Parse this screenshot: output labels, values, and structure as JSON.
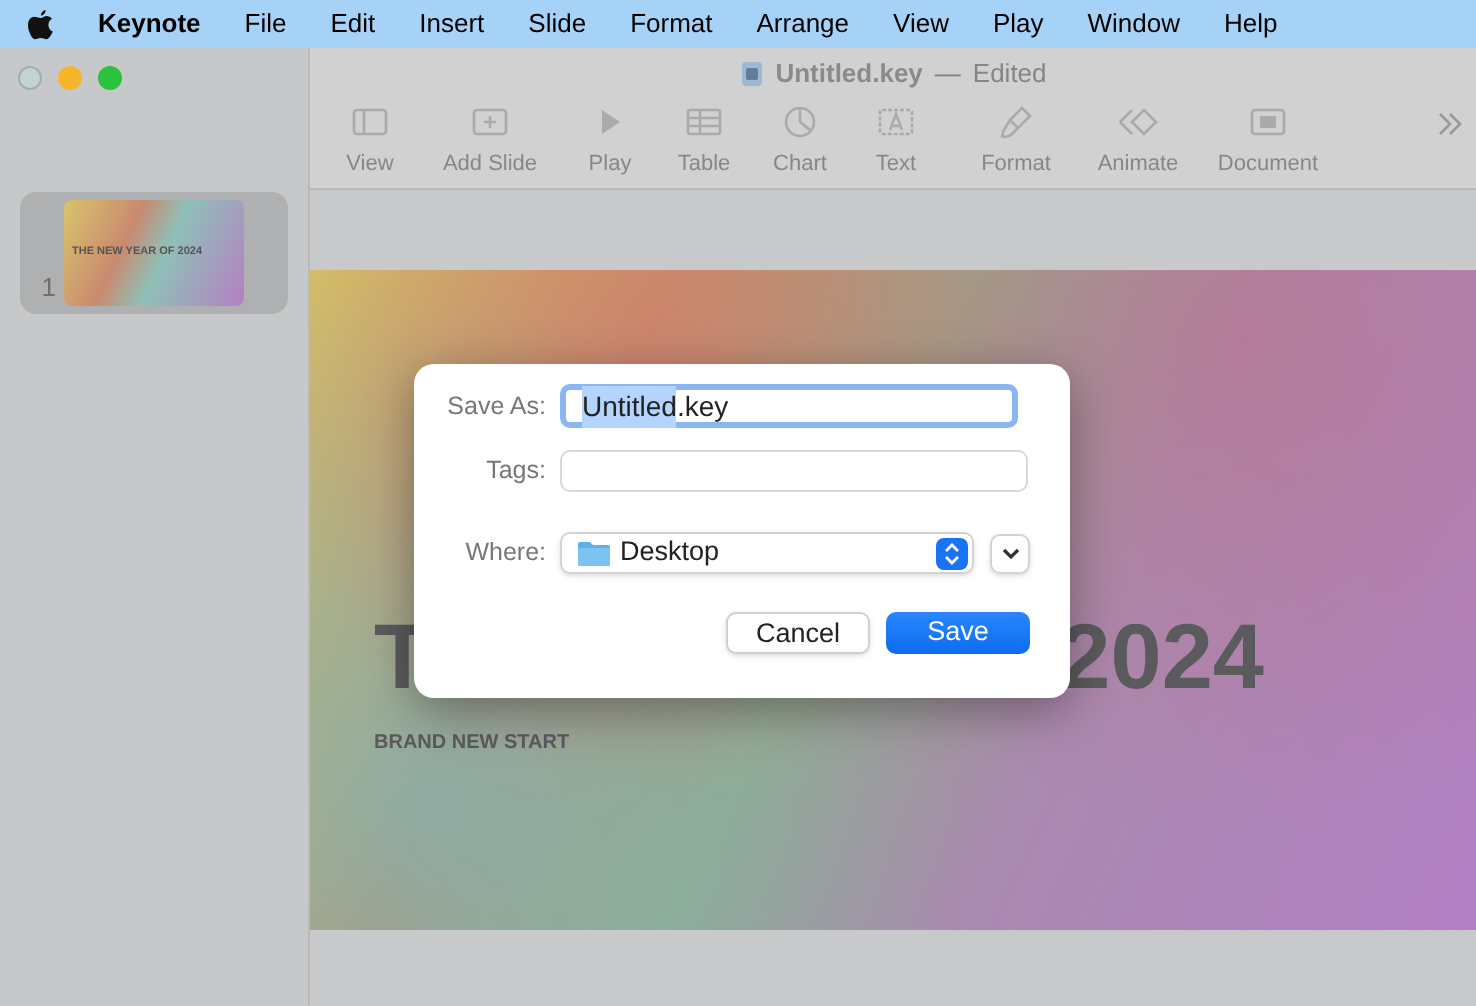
{
  "menu_bar": {
    "app_name": "Keynote",
    "items": [
      "File",
      "Edit",
      "Insert",
      "Slide",
      "Format",
      "Arrange",
      "View",
      "Play",
      "Window",
      "Help"
    ]
  },
  "window": {
    "title": "Untitled.key",
    "separator": "—",
    "status": "Edited"
  },
  "toolbar": {
    "items": [
      {
        "label": "View"
      },
      {
        "label": "Add Slide"
      },
      {
        "label": "Play"
      },
      {
        "label": "Table"
      },
      {
        "label": "Chart"
      },
      {
        "label": "Text"
      },
      {
        "label": "Format"
      },
      {
        "label": "Animate"
      },
      {
        "label": "Document"
      }
    ]
  },
  "slide_navigator": {
    "slides": [
      {
        "number": "1",
        "title": "THE NEW YEAR OF 2024",
        "selected": true
      }
    ]
  },
  "slide": {
    "title_parts": [
      "T",
      "2024"
    ],
    "subtitle": "BRAND NEW START"
  },
  "save_dialog": {
    "save_as": {
      "label": "Save As:",
      "value_parts": [
        {
          "text": "Untitled",
          "selected": true
        },
        {
          "text": ".key",
          "selected": false
        }
      ]
    },
    "tags": {
      "label": "Tags:"
    },
    "where": {
      "label": "Where:",
      "value": "Desktop"
    },
    "buttons": [
      {
        "label": "Cancel",
        "kind": "secondary"
      },
      {
        "label": "Save",
        "kind": "default"
      }
    ]
  }
}
